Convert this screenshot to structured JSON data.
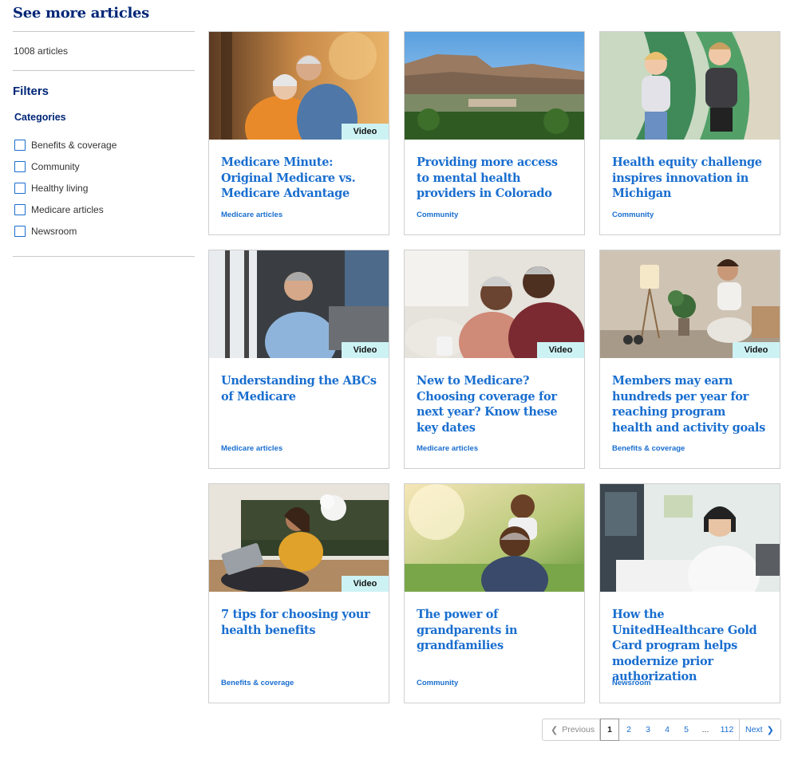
{
  "page": {
    "title": "See more articles"
  },
  "sidebar": {
    "article_count": "1008 articles",
    "filters_title": "Filters",
    "categories_title": "Categories",
    "categories": [
      "Benefits & coverage",
      "Community",
      "Healthy living",
      "Medicare articles",
      "Newsroom"
    ]
  },
  "cards": [
    {
      "title": "Medicare Minute: Original Medicare vs. Medicare Advantage",
      "category": "Medicare articles",
      "badge": "Video"
    },
    {
      "title": "Providing more access to mental health providers in Colorado",
      "category": "Community",
      "badge": ""
    },
    {
      "title": "Health equity challenge inspires innovation in Michigan",
      "category": "Community",
      "badge": ""
    },
    {
      "title": "Understanding the ABCs of Medicare",
      "category": "Medicare articles",
      "badge": "Video"
    },
    {
      "title": "New to Medicare? Choosing coverage for next year? Know these key dates",
      "category": "Medicare articles",
      "badge": "Video"
    },
    {
      "title": "Members may earn hundreds per year for reaching program health and activity goals",
      "category": "Benefits & coverage",
      "badge": "Video"
    },
    {
      "title": "7 tips for choosing your health benefits",
      "category": "Benefits & coverage",
      "badge": "Video"
    },
    {
      "title": "The power of grandparents in grandfamilies",
      "category": "Community",
      "badge": ""
    },
    {
      "title": "How the UnitedHealthcare Gold Card program helps modernize prior authorization",
      "category": "Newsroom",
      "badge": ""
    }
  ],
  "pagination": {
    "previous": "Previous",
    "pages": [
      "1",
      "2",
      "3",
      "4",
      "5"
    ],
    "ellipsis": "...",
    "last": "112",
    "next": "Next"
  },
  "colors": {
    "brand_navy": "#002677",
    "link_blue": "#196ecf",
    "badge_bg": "#cdf2f4"
  }
}
